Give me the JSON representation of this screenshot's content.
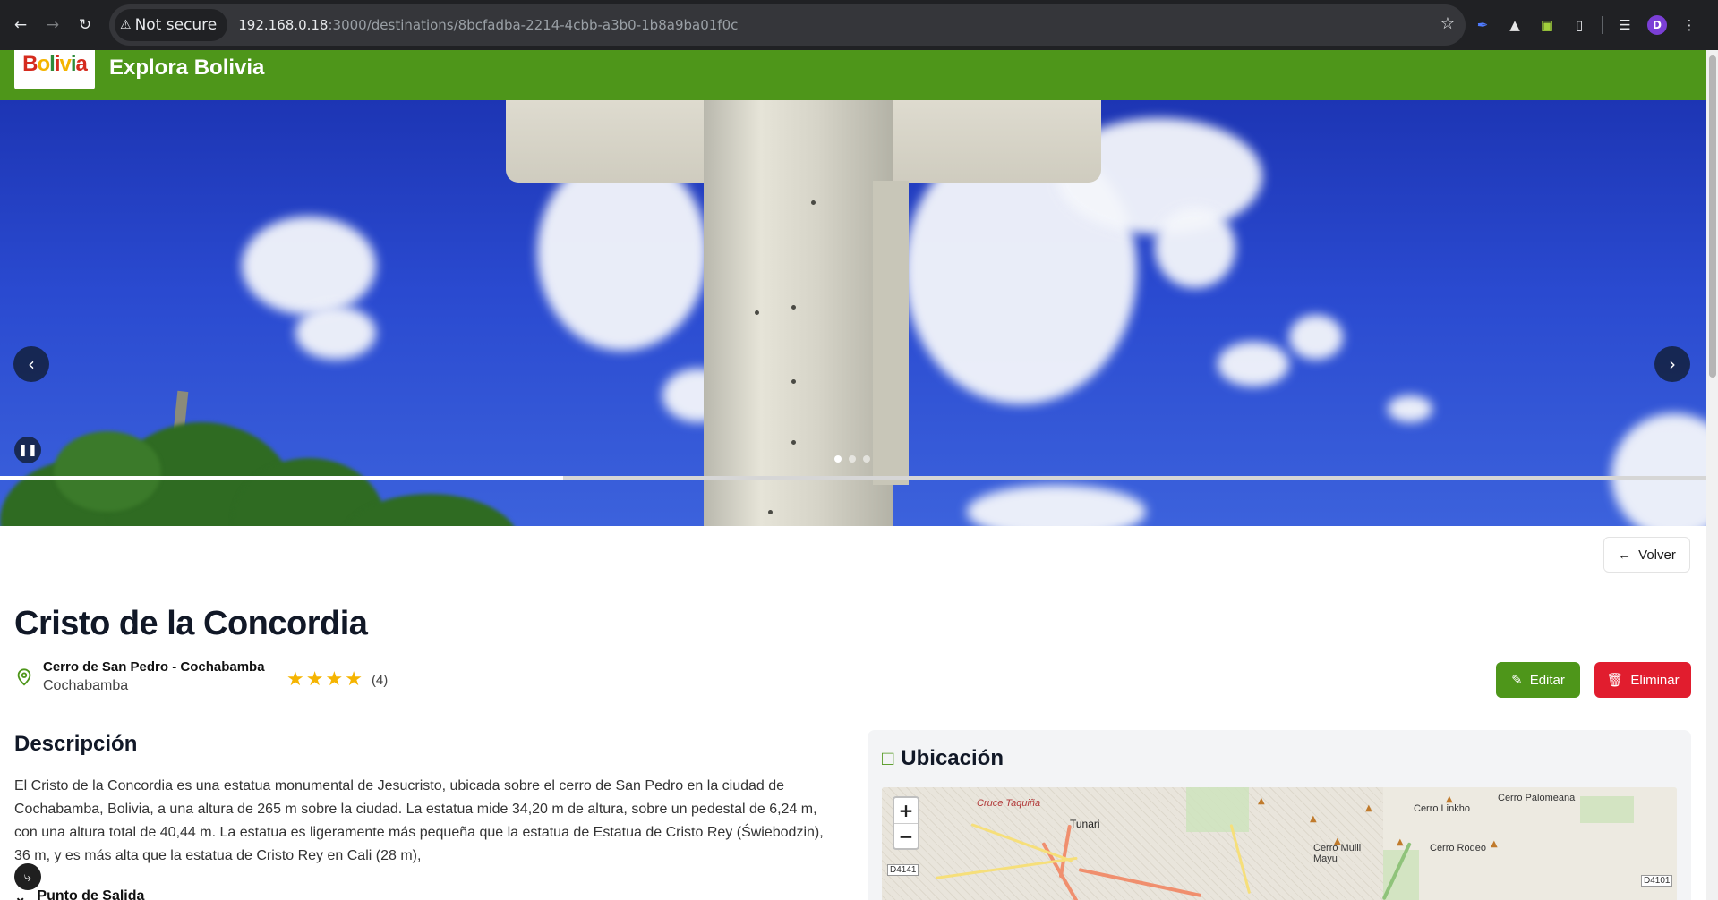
{
  "browser": {
    "security_label": "Not secure",
    "url_host": "192.168.0.18",
    "url_path": ":3000/destinations/8bcfadba-2214-4cbb-a3b0-1b8a9ba01f0c",
    "profile_initial": "D"
  },
  "site": {
    "logo_text": "Bolivia",
    "title": "Explora Bolivia"
  },
  "carousel": {
    "slides_total": 3,
    "active_slide": 1,
    "progress_fraction": 0.33
  },
  "actions": {
    "back_label": "Volver",
    "edit_label": "Editar",
    "delete_label": "Eliminar"
  },
  "destination": {
    "name": "Cristo de la Concordia",
    "place": "Cerro de San Pedro - Cochabamba",
    "city": "Cochabamba",
    "rating_stars": 4,
    "rating_count": "(4)",
    "description_title": "Descripción",
    "description": "El Cristo de la Concordia es una estatua monumental de Jesucristo, ubicada sobre el cerro de San Pedro en la ciudad de Cochabamba, Bolivia, a una altura de 265 m sobre la ciudad. La estatua mide 34,20 m de altura, sobre un pedestal de 6,24 m, con una altura total de 40,44 m. La estatua es ligeramente más pequeña que la estatua de Estatua de Cristo Rey (Świebodzin), 36 m, y es más alta que la estatua de Cristo Rey en Cali (28 m),",
    "departure_label": "Punto de Salida"
  },
  "location_card": {
    "title": "Ubicación",
    "map_labels": {
      "cruce": "Cruce Taquiña",
      "tunari": "Tunari",
      "linkho": "Cerro Linkho",
      "palomeana": "Cerro Palomeana",
      "mulli": "Cerro Mulli Mayu",
      "rodeo": "Cerro Rodeo",
      "road_left": "D4141",
      "road_right": "D4101"
    }
  },
  "icons": {
    "back": "arrow-left-icon",
    "edit": "edit-icon",
    "delete": "trash-icon",
    "location": "map-pin-icon",
    "map": "map-icon",
    "star": "star-icon"
  },
  "colors": {
    "brand_green": "#4e961a",
    "danger_red": "#e11d2e",
    "star_yellow": "#f5b400"
  }
}
